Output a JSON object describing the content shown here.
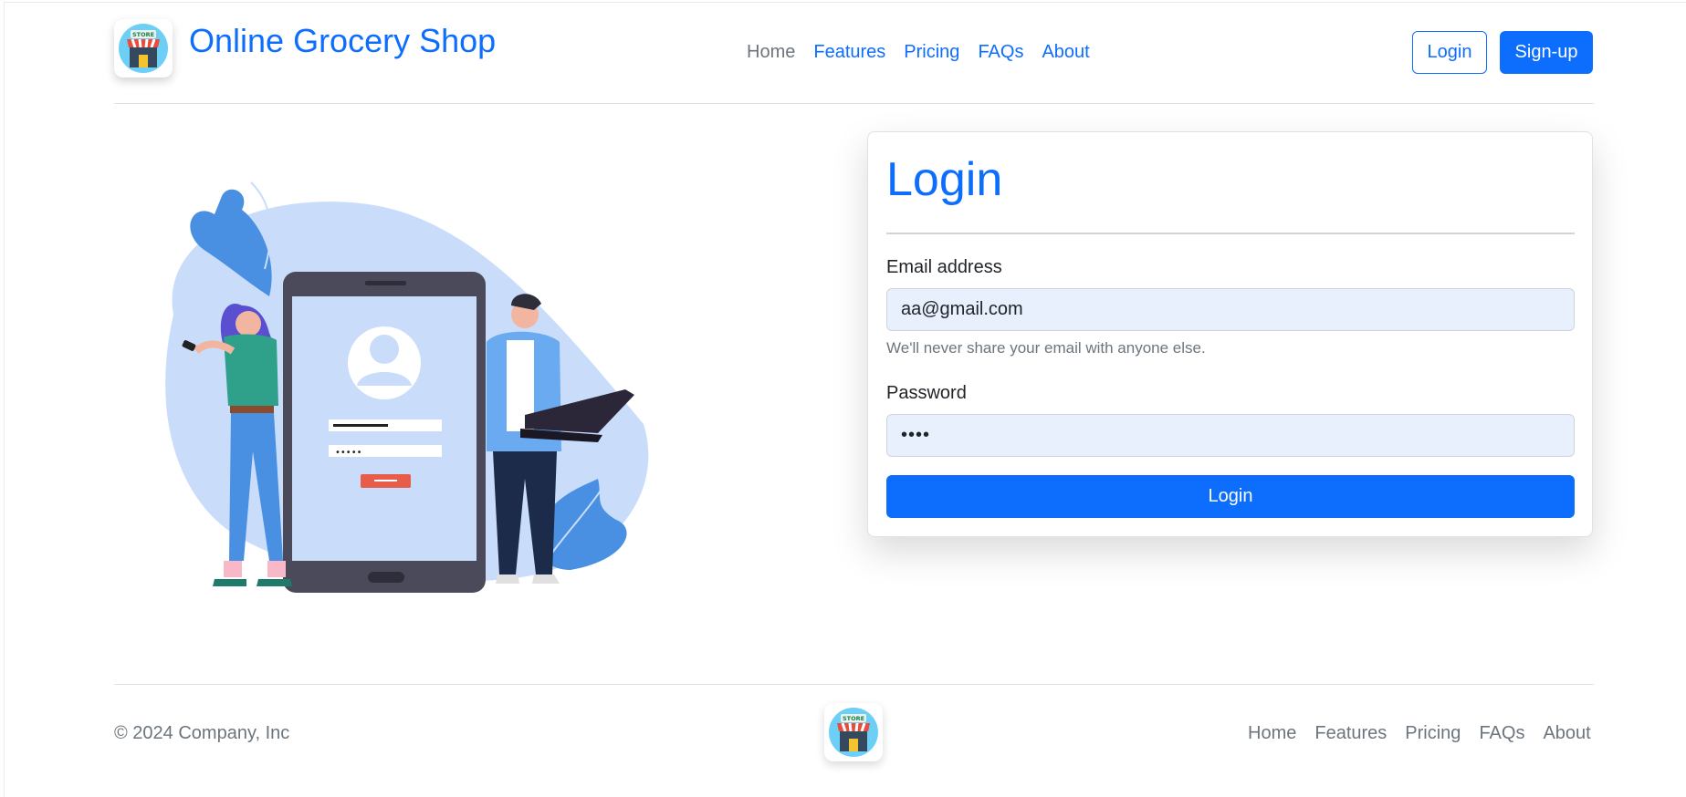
{
  "header": {
    "brand": "Online Grocery Shop",
    "logo_text": "STORE",
    "nav": [
      {
        "label": "Home",
        "active": false
      },
      {
        "label": "Features",
        "active": true
      },
      {
        "label": "Pricing",
        "active": true
      },
      {
        "label": "FAQs",
        "active": true
      },
      {
        "label": "About",
        "active": true
      }
    ],
    "login_label": "Login",
    "signup_label": "Sign-up"
  },
  "form": {
    "title": "Login",
    "email_label": "Email address",
    "email_value": "aa@gmail.com",
    "email_help": "We'll never share your email with anyone else.",
    "password_label": "Password",
    "password_value": "••••",
    "submit_label": "Login"
  },
  "footer": {
    "copyright": "© 2024 Company, Inc",
    "logo_text": "STORE",
    "nav": [
      "Home",
      "Features",
      "Pricing",
      "FAQs",
      "About"
    ]
  },
  "colors": {
    "primary": "#0d6efd",
    "muted": "#6c757d",
    "input_bg": "#e8f0fe"
  }
}
